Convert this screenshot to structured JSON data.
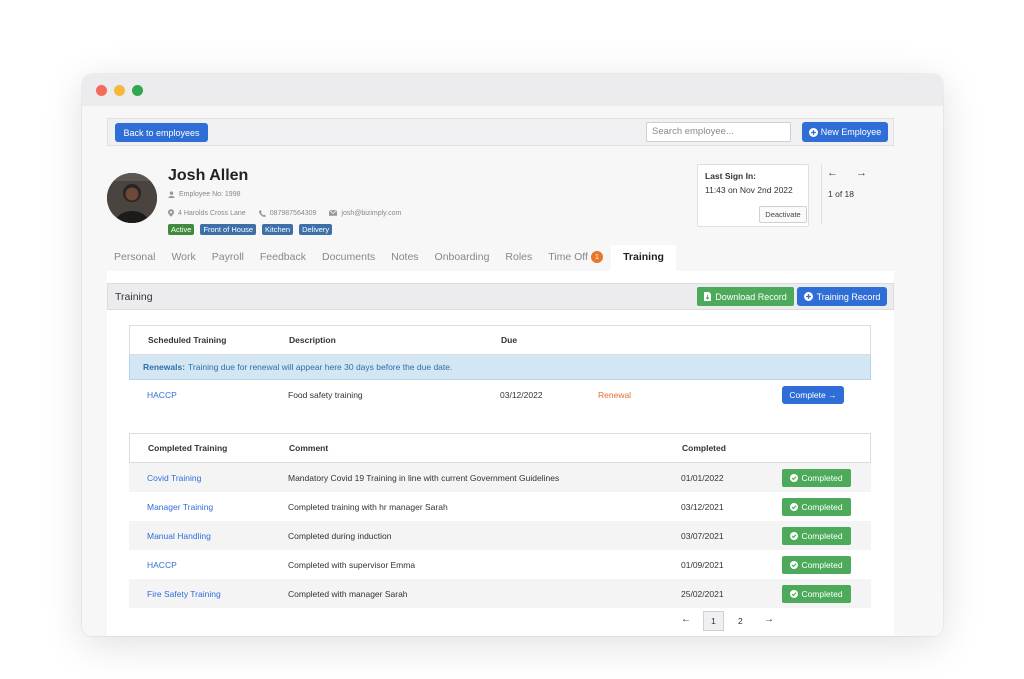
{
  "window": {
    "dots": [
      "#f26b5b",
      "#f5b93a",
      "#2fa84f"
    ]
  },
  "topbar": {
    "back_label": "Back to employees",
    "search_placeholder": "Search employee...",
    "new_employee_label": "New Employee"
  },
  "employee": {
    "name": "Josh Allen",
    "employee_no": "Employee No: 1998",
    "address": "4 Harolds Cross Lane",
    "phone": "087987564309",
    "email": "josh@bizimply.com",
    "tags": [
      {
        "label": "Active",
        "color": "#3f8a3c"
      },
      {
        "label": "Front of House",
        "color": "#3d6fa8"
      },
      {
        "label": "Kitchen",
        "color": "#3d6fa8"
      },
      {
        "label": "Delivery",
        "color": "#3d6fa8"
      }
    ]
  },
  "signin": {
    "title": "Last Sign In:",
    "time": "11:43 on Nov 2nd 2022",
    "deactivate_label": "Deactivate"
  },
  "nav": {
    "prev": "←",
    "next": "→",
    "count": "1 of 18"
  },
  "tabs": {
    "personal": "Personal",
    "work": "Work",
    "payroll": "Payroll",
    "feedback": "Feedback",
    "documents": "Documents",
    "notes": "Notes",
    "onboarding": "Onboarding",
    "roles": "Roles",
    "time_off": "Time Off",
    "time_off_badge": "1",
    "training": "Training"
  },
  "section": {
    "title": "Training",
    "download_label": "Download Record",
    "training_record_label": "Training Record"
  },
  "scheduled": {
    "headers": {
      "name": "Scheduled Training",
      "description": "Description",
      "due": "Due"
    },
    "renewal_note_bold": "Renewals:",
    "renewal_note": "Training due for renewal will appear here 30 days before the due date.",
    "rows": [
      {
        "name": "HACCP",
        "description": "Food safety training",
        "due": "03/12/2022",
        "status": "Renewal",
        "action": "Complete →"
      }
    ]
  },
  "completed": {
    "headers": {
      "name": "Completed Training",
      "comment": "Comment",
      "completed": "Completed"
    },
    "button_label": "Completed",
    "rows": [
      {
        "name": "Covid Training",
        "comment": "Mandatory Covid 19 Training in line with current Government Guidelines",
        "date": "01/01/2022"
      },
      {
        "name": "Manager Training",
        "comment": "Completed training with hr manager Sarah",
        "date": "03/12/2021"
      },
      {
        "name": "Manual Handling",
        "comment": "Completed during induction",
        "date": "03/07/2021"
      },
      {
        "name": "HACCP",
        "comment": "Completed with supervisor Emma",
        "date": "01/09/2021"
      },
      {
        "name": "Fire Safety Training",
        "comment": "Completed with manager Sarah",
        "date": "25/02/2021"
      }
    ]
  },
  "pagination": {
    "prev": "←",
    "page1": "1",
    "page2": "2",
    "next": "→"
  }
}
